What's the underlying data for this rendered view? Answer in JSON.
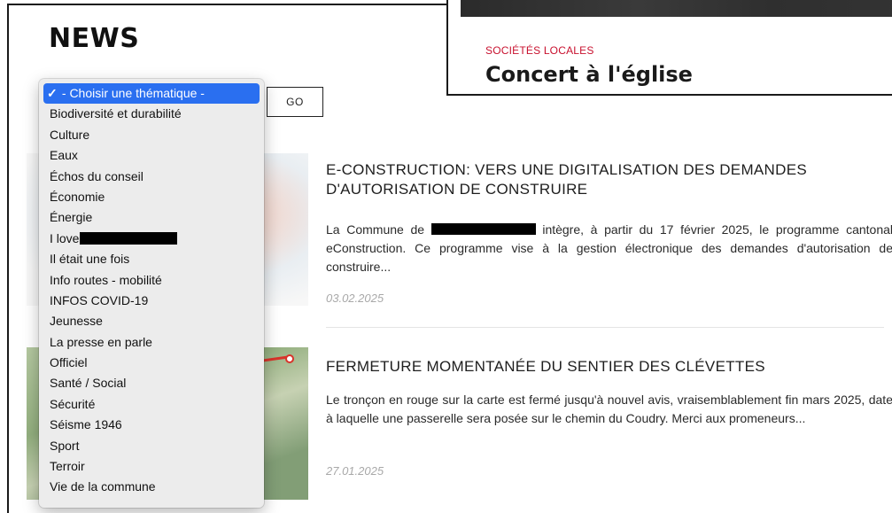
{
  "page": {
    "section_title": "NEWS",
    "go_label": "GO"
  },
  "featured": {
    "category": "SOCIÉTÉS LOCALES",
    "title": "Concert à l'église"
  },
  "theme_select": {
    "selected": "- Choisir une thématique -",
    "options": [
      "- Choisir une thématique -",
      "Biodiversité et durabilité",
      "Culture",
      "Eaux",
      "Échos du conseil",
      "Économie",
      "Énergie",
      "I love",
      "Il était une fois",
      "Info routes - mobilité",
      "INFOS COVID-19",
      "Jeunesse",
      "La presse en parle",
      "Officiel",
      "Santé / Social",
      "Sécurité",
      "Séisme 1946",
      "Sport",
      "Terroir",
      "Vie de la commune"
    ]
  },
  "articles": [
    {
      "title": "E-CONSTRUCTION: VERS UNE DIGITALISATION DES DEMANDES D'AUTORISATION DE CONSTRUIRE",
      "body_before": "La Commune de",
      "body_after": "intègre, à partir du 17 février 2025, le programme cantonal eConstruction. Ce programme vise à la gestion électronique des demandes d'autorisation de construire...",
      "date": "03.02.2025"
    },
    {
      "title": "FERMETURE MOMENTANÉE DU SENTIER DES CLÉVETTES",
      "body": "Le tronçon en rouge sur la carte est fermé jusqu'à nouvel avis, vraisemblablement fin mars 2025, date à laquelle une passerelle sera posée sur le chemin du Coudry. Merci aux promeneurs...",
      "date": "27.01.2025"
    }
  ]
}
